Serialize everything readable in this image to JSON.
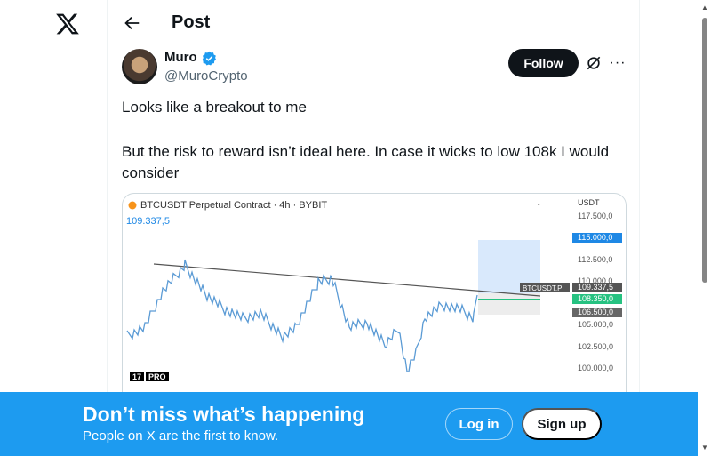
{
  "header": {
    "title": "Post"
  },
  "tweet": {
    "author_name": "Muro",
    "author_handle": "@MuroCrypto",
    "follow_label": "Follow",
    "more_label": "···",
    "line1": "Looks like a breakout to me",
    "line2": "But the risk to reward isn’t ideal here. In case it wicks to low 108k I would consider"
  },
  "media": {
    "chart_title": "BTCUSDT Perpetual Contract · 4h · BYBIT",
    "current_price": "109.337,5",
    "currency": "USDT",
    "logo_text": "17",
    "logo_badge": "PRO",
    "axis_ticks": [
      "117.500,0",
      "115.000,0",
      "112.500,0",
      "110.000,0",
      "109.337,5",
      "108.350,0",
      "106.500,0",
      "105.000,0",
      "102.500,0",
      "100.000,0"
    ],
    "symbol_tag": "BTCUSDT.P",
    "colors": {
      "candles": "#5b9bd5",
      "target_zone": "#cfe4fb",
      "entry": "#26c281",
      "trendline": "#555555"
    }
  },
  "banner": {
    "title": "Don’t miss what’s happening",
    "subtitle": "People on X are the first to know.",
    "login_label": "Log in",
    "signup_label": "Sign up"
  },
  "colors": {
    "accent": "#1d9bf0",
    "verified": "#1d9bf0"
  }
}
